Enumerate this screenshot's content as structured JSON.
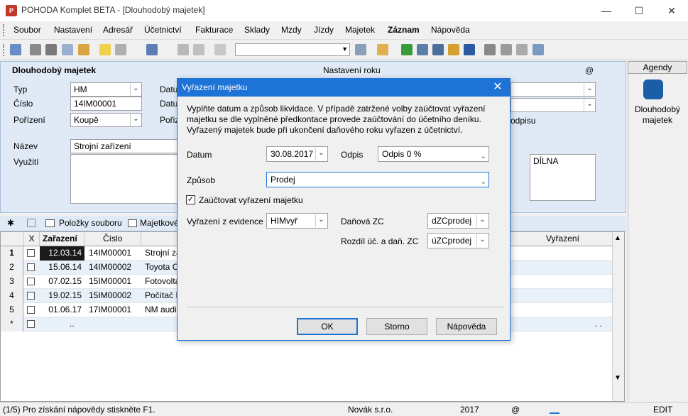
{
  "window": {
    "title": "POHODA Komplet BETA - [Dlouhodobý majetek]",
    "minimize_glyph": "—",
    "maximize_glyph": "☐",
    "close_glyph": "✕"
  },
  "menu": [
    "Soubor",
    "Nastavení",
    "Adresář",
    "Účetnictví",
    "Fakturace",
    "Sklady",
    "Mzdy",
    "Jízdy",
    "Majetek",
    "Záznam",
    "Nápověda"
  ],
  "form": {
    "heading": "Dlouhodobý majetek",
    "settings_label": "Nastavení roku",
    "at_symbol": "@",
    "typ_label": "Typ",
    "typ_value": "HM",
    "cislo_label": "Číslo",
    "cislo_value": "14IM00001",
    "porizeni_label": "Pořízení",
    "porizeni_value": "Koupě",
    "datum_label1": "Datu",
    "datum_label2": "Datu",
    "poriz_label": "Pořiz",
    "nazev_label": "Název",
    "nazev_value": "Strojní zařízení",
    "vyuziti_label": "Využití",
    "odpisu_label": "odpisu",
    "dilna_value": "DÍLNA"
  },
  "tabs": {
    "star": "✱",
    "polozky": "Položky souboru",
    "majetkove": "Majetkové"
  },
  "grid": {
    "headers": [
      "X",
      "Zařazení",
      "Číslo",
      "Vyřazení"
    ],
    "rows": [
      {
        "num": "1",
        "date": "12.03.14",
        "cislo": "14IM00001",
        "nazev": "Strojní za"
      },
      {
        "num": "2",
        "date": "15.06.14",
        "cislo": "14IM00002",
        "nazev": "Toyota C"
      },
      {
        "num": "3",
        "date": "07.02.15",
        "cislo": "15IM00001",
        "nazev": "Fotovolta"
      },
      {
        "num": "4",
        "date": "19.02.15",
        "cislo": "15IM00002",
        "nazev": "Počítač I"
      },
      {
        "num": "5",
        "date": "01.06.17",
        "cislo": "17IM00001",
        "nazev": "NM audi"
      }
    ],
    "new_row_marker": "*",
    "new_row_dots": "..",
    "new_row_dots2": ". ."
  },
  "right_panel": {
    "header": "Agendy",
    "item_label": "Dlouhodobý majetek"
  },
  "status": {
    "help": "(1/5) Pro získání nápovědy stiskněte F1.",
    "company": "Novák s.r.o.",
    "year": "2017",
    "at": "@",
    "mode": "EDIT"
  },
  "dialog": {
    "title": "Vyřazení majetku",
    "close_glyph": "✕",
    "description": "Vyplňte datum a způsob likvidace. V případě zatržené volby zaúčtovat vyřazení majetku se dle vyplněné předkontace provede zaúčtování do účetního deníku. Vyřazený majetek bude při ukončení daňového roku vyřazen z účetnictví.",
    "datum_label": "Datum",
    "datum_value": "30.08.2017",
    "odpis_label": "Odpis",
    "odpis_value": "Odpis 0 %",
    "zpusob_label": "Způsob",
    "zpusob_value": "Prodej",
    "checkbox_label": "Zaúčtovat vyřazení majetku",
    "checkbox_checked": true,
    "vyrazeni_label": "Vyřazení z evidence",
    "vyrazeni_value": "HIMvyř",
    "danova_label": "Daňová ZC",
    "danova_value": "dZCprodej",
    "rozdil_label": "Rozdíl úč. a daň. ZC",
    "rozdil_value": "úZCprodej",
    "ok": "OK",
    "storno": "Storno",
    "napoveda": "Nápověda"
  }
}
